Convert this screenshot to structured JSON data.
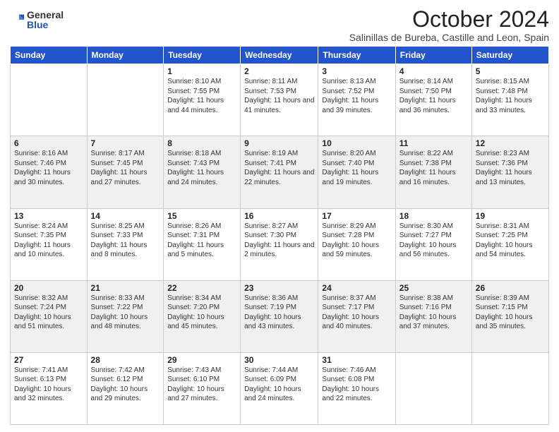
{
  "header": {
    "logo_general": "General",
    "logo_blue": "Blue",
    "main_title": "October 2024",
    "sub_title": "Salinillas de Bureba, Castille and Leon, Spain"
  },
  "days_of_week": [
    "Sunday",
    "Monday",
    "Tuesday",
    "Wednesday",
    "Thursday",
    "Friday",
    "Saturday"
  ],
  "weeks": [
    [
      {
        "day": "",
        "sunrise": "",
        "sunset": "",
        "daylight": ""
      },
      {
        "day": "",
        "sunrise": "",
        "sunset": "",
        "daylight": ""
      },
      {
        "day": "1",
        "sunrise": "Sunrise: 8:10 AM",
        "sunset": "Sunset: 7:55 PM",
        "daylight": "Daylight: 11 hours and 44 minutes."
      },
      {
        "day": "2",
        "sunrise": "Sunrise: 8:11 AM",
        "sunset": "Sunset: 7:53 PM",
        "daylight": "Daylight: 11 hours and 41 minutes."
      },
      {
        "day": "3",
        "sunrise": "Sunrise: 8:13 AM",
        "sunset": "Sunset: 7:52 PM",
        "daylight": "Daylight: 11 hours and 39 minutes."
      },
      {
        "day": "4",
        "sunrise": "Sunrise: 8:14 AM",
        "sunset": "Sunset: 7:50 PM",
        "daylight": "Daylight: 11 hours and 36 minutes."
      },
      {
        "day": "5",
        "sunrise": "Sunrise: 8:15 AM",
        "sunset": "Sunset: 7:48 PM",
        "daylight": "Daylight: 11 hours and 33 minutes."
      }
    ],
    [
      {
        "day": "6",
        "sunrise": "Sunrise: 8:16 AM",
        "sunset": "Sunset: 7:46 PM",
        "daylight": "Daylight: 11 hours and 30 minutes."
      },
      {
        "day": "7",
        "sunrise": "Sunrise: 8:17 AM",
        "sunset": "Sunset: 7:45 PM",
        "daylight": "Daylight: 11 hours and 27 minutes."
      },
      {
        "day": "8",
        "sunrise": "Sunrise: 8:18 AM",
        "sunset": "Sunset: 7:43 PM",
        "daylight": "Daylight: 11 hours and 24 minutes."
      },
      {
        "day": "9",
        "sunrise": "Sunrise: 8:19 AM",
        "sunset": "Sunset: 7:41 PM",
        "daylight": "Daylight: 11 hours and 22 minutes."
      },
      {
        "day": "10",
        "sunrise": "Sunrise: 8:20 AM",
        "sunset": "Sunset: 7:40 PM",
        "daylight": "Daylight: 11 hours and 19 minutes."
      },
      {
        "day": "11",
        "sunrise": "Sunrise: 8:22 AM",
        "sunset": "Sunset: 7:38 PM",
        "daylight": "Daylight: 11 hours and 16 minutes."
      },
      {
        "day": "12",
        "sunrise": "Sunrise: 8:23 AM",
        "sunset": "Sunset: 7:36 PM",
        "daylight": "Daylight: 11 hours and 13 minutes."
      }
    ],
    [
      {
        "day": "13",
        "sunrise": "Sunrise: 8:24 AM",
        "sunset": "Sunset: 7:35 PM",
        "daylight": "Daylight: 11 hours and 10 minutes."
      },
      {
        "day": "14",
        "sunrise": "Sunrise: 8:25 AM",
        "sunset": "Sunset: 7:33 PM",
        "daylight": "Daylight: 11 hours and 8 minutes."
      },
      {
        "day": "15",
        "sunrise": "Sunrise: 8:26 AM",
        "sunset": "Sunset: 7:31 PM",
        "daylight": "Daylight: 11 hours and 5 minutes."
      },
      {
        "day": "16",
        "sunrise": "Sunrise: 8:27 AM",
        "sunset": "Sunset: 7:30 PM",
        "daylight": "Daylight: 11 hours and 2 minutes."
      },
      {
        "day": "17",
        "sunrise": "Sunrise: 8:29 AM",
        "sunset": "Sunset: 7:28 PM",
        "daylight": "Daylight: 10 hours and 59 minutes."
      },
      {
        "day": "18",
        "sunrise": "Sunrise: 8:30 AM",
        "sunset": "Sunset: 7:27 PM",
        "daylight": "Daylight: 10 hours and 56 minutes."
      },
      {
        "day": "19",
        "sunrise": "Sunrise: 8:31 AM",
        "sunset": "Sunset: 7:25 PM",
        "daylight": "Daylight: 10 hours and 54 minutes."
      }
    ],
    [
      {
        "day": "20",
        "sunrise": "Sunrise: 8:32 AM",
        "sunset": "Sunset: 7:24 PM",
        "daylight": "Daylight: 10 hours and 51 minutes."
      },
      {
        "day": "21",
        "sunrise": "Sunrise: 8:33 AM",
        "sunset": "Sunset: 7:22 PM",
        "daylight": "Daylight: 10 hours and 48 minutes."
      },
      {
        "day": "22",
        "sunrise": "Sunrise: 8:34 AM",
        "sunset": "Sunset: 7:20 PM",
        "daylight": "Daylight: 10 hours and 45 minutes."
      },
      {
        "day": "23",
        "sunrise": "Sunrise: 8:36 AM",
        "sunset": "Sunset: 7:19 PM",
        "daylight": "Daylight: 10 hours and 43 minutes."
      },
      {
        "day": "24",
        "sunrise": "Sunrise: 8:37 AM",
        "sunset": "Sunset: 7:17 PM",
        "daylight": "Daylight: 10 hours and 40 minutes."
      },
      {
        "day": "25",
        "sunrise": "Sunrise: 8:38 AM",
        "sunset": "Sunset: 7:16 PM",
        "daylight": "Daylight: 10 hours and 37 minutes."
      },
      {
        "day": "26",
        "sunrise": "Sunrise: 8:39 AM",
        "sunset": "Sunset: 7:15 PM",
        "daylight": "Daylight: 10 hours and 35 minutes."
      }
    ],
    [
      {
        "day": "27",
        "sunrise": "Sunrise: 7:41 AM",
        "sunset": "Sunset: 6:13 PM",
        "daylight": "Daylight: 10 hours and 32 minutes."
      },
      {
        "day": "28",
        "sunrise": "Sunrise: 7:42 AM",
        "sunset": "Sunset: 6:12 PM",
        "daylight": "Daylight: 10 hours and 29 minutes."
      },
      {
        "day": "29",
        "sunrise": "Sunrise: 7:43 AM",
        "sunset": "Sunset: 6:10 PM",
        "daylight": "Daylight: 10 hours and 27 minutes."
      },
      {
        "day": "30",
        "sunrise": "Sunrise: 7:44 AM",
        "sunset": "Sunset: 6:09 PM",
        "daylight": "Daylight: 10 hours and 24 minutes."
      },
      {
        "day": "31",
        "sunrise": "Sunrise: 7:46 AM",
        "sunset": "Sunset: 6:08 PM",
        "daylight": "Daylight: 10 hours and 22 minutes."
      },
      {
        "day": "",
        "sunrise": "",
        "sunset": "",
        "daylight": ""
      },
      {
        "day": "",
        "sunrise": "",
        "sunset": "",
        "daylight": ""
      }
    ]
  ]
}
